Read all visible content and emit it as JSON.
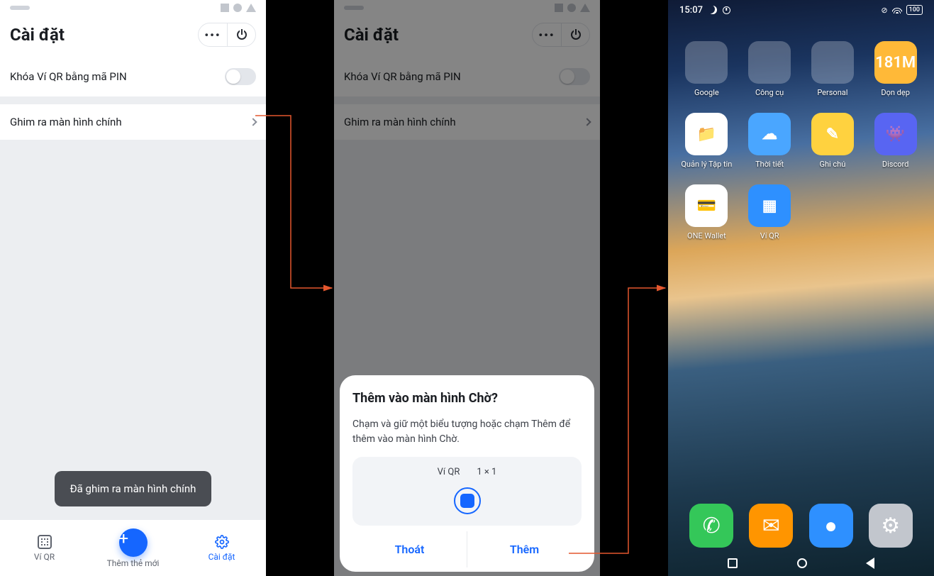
{
  "screen1": {
    "title": "Cài đặt",
    "row_pin": "Khóa Ví QR bằng mã PIN",
    "row_home": "Ghim ra màn hình chính",
    "toast": "Đã ghim ra màn hình chính",
    "tabs": {
      "wallet": "Ví QR",
      "add": "Thêm thẻ mới",
      "settings": "Cài đặt"
    }
  },
  "screen2": {
    "title": "Cài đặt",
    "row_pin": "Khóa Ví QR bằng mã PIN",
    "row_home": "Ghim ra màn hình chính",
    "dialog": {
      "title": "Thêm vào màn hình Chờ?",
      "body": "Chạm và giữ một biểu tượng hoặc chạm Thêm để thêm vào màn hình Chờ.",
      "widget_name": "Ví QR",
      "widget_size": "1 × 1",
      "cancel": "Thoát",
      "confirm": "Thêm"
    }
  },
  "screen3": {
    "time": "15:07",
    "battery": "100",
    "apps": [
      {
        "name": "Google",
        "kind": "folder",
        "cells": [
          "#ea4335",
          "#fbbc04",
          "#4285f4",
          "#ffffff",
          "#34a853",
          "#ea4335",
          "#fbbc04",
          "#4285f4",
          "#ea4335"
        ]
      },
      {
        "name": "Công cụ",
        "kind": "folder",
        "cells": [
          "#ff9d42",
          "#4aa3ff",
          "#7a4aff",
          "#4aa3ff",
          "#ffce3d",
          "#7a4aff",
          "#ff5f6d",
          "#4aa3ff",
          "#3ddc97"
        ]
      },
      {
        "name": "Personal",
        "kind": "folder",
        "cells": [
          "#30d158",
          "#ffffff",
          "#0a84ff",
          "#ffffff",
          "#2fbef0",
          "#ffffff",
          "#ffffff",
          "#ffffff",
          "#ffffff"
        ]
      },
      {
        "name": "Dọn dẹp",
        "kind": "icon",
        "bg": "#ffb938",
        "fg": "#ffffff",
        "text": "181M"
      },
      {
        "name": "Quản lý Tập tin",
        "kind": "icon",
        "bg": "#ffffff",
        "fg": "#ffb938",
        "text": "📁"
      },
      {
        "name": "Thời tiết",
        "kind": "icon",
        "bg": "#4aa6ff",
        "fg": "#ffffff",
        "text": "☁"
      },
      {
        "name": "Ghi chú",
        "kind": "icon",
        "bg": "#ffd23f",
        "fg": "#ffffff",
        "text": "✎"
      },
      {
        "name": "Discord",
        "kind": "icon",
        "bg": "#5865f2",
        "fg": "#ffffff",
        "text": "👾"
      },
      {
        "name": "ONE Wallet",
        "kind": "icon",
        "bg": "#ffffff",
        "fg": "#ff7a18",
        "text": "💳"
      },
      {
        "name": "Ví QR",
        "kind": "icon",
        "bg": "#2e90ff",
        "fg": "#ffffff",
        "text": "▦"
      }
    ],
    "dock": [
      {
        "name": "Phone",
        "bg": "#34c759",
        "glyph": "✆"
      },
      {
        "name": "Messages",
        "bg": "#ff9500",
        "glyph": "✉"
      },
      {
        "name": "Browser",
        "bg": "#2e90ff",
        "glyph": "●"
      },
      {
        "name": "Settings",
        "bg": "#c2c6cd",
        "glyph": "⚙"
      }
    ]
  }
}
